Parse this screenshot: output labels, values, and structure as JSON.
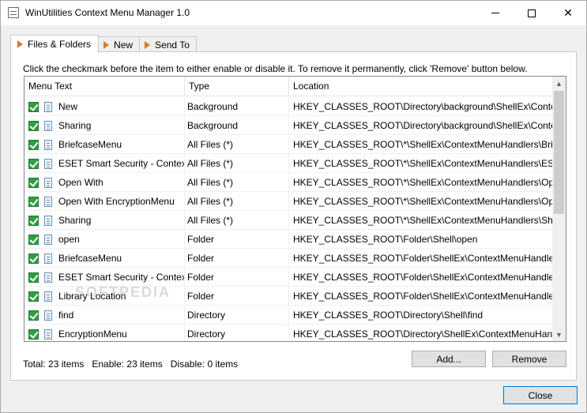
{
  "window": {
    "title": "WinUtilities Context Menu Manager 1.0",
    "controls": {
      "minimize": "minimize",
      "maximize": "maximize",
      "close": "close"
    }
  },
  "tabs": [
    {
      "label": "Files & Folders",
      "active": true
    },
    {
      "label": "New",
      "active": false
    },
    {
      "label": "Send To",
      "active": false
    }
  ],
  "instructions": "Click the checkmark before the item to either enable or disable it. To remove it permanently, click 'Remove' button below.",
  "table": {
    "columns": [
      "Menu Text",
      "Type",
      "Location"
    ],
    "rows": [
      {
        "menu_text": "New",
        "type": "Background",
        "location": "HKEY_CLASSES_ROOT\\Directory\\background\\ShellEx\\ContextMe..."
      },
      {
        "menu_text": "Sharing",
        "type": "Background",
        "location": "HKEY_CLASSES_ROOT\\Directory\\background\\ShellEx\\ContextMe..."
      },
      {
        "menu_text": "BriefcaseMenu",
        "type": "All Files (*)",
        "location": "HKEY_CLASSES_ROOT\\*\\ShellEx\\ContextMenuHandlers\\Briefcase..."
      },
      {
        "menu_text": "ESET Smart Security - Contex...",
        "type": "All Files (*)",
        "location": "HKEY_CLASSES_ROOT\\*\\ShellEx\\ContextMenuHandlers\\ESET Sm..."
      },
      {
        "menu_text": "Open With",
        "type": "All Files (*)",
        "location": "HKEY_CLASSES_ROOT\\*\\ShellEx\\ContextMenuHandlers\\Open With"
      },
      {
        "menu_text": "Open With EncryptionMenu",
        "type": "All Files (*)",
        "location": "HKEY_CLASSES_ROOT\\*\\ShellEx\\ContextMenuHandlers\\Open Wi..."
      },
      {
        "menu_text": "Sharing",
        "type": "All Files (*)",
        "location": "HKEY_CLASSES_ROOT\\*\\ShellEx\\ContextMenuHandlers\\Sharing"
      },
      {
        "menu_text": "open",
        "type": "Folder",
        "location": "HKEY_CLASSES_ROOT\\Folder\\Shell\\open"
      },
      {
        "menu_text": "BriefcaseMenu",
        "type": "Folder",
        "location": "HKEY_CLASSES_ROOT\\Folder\\ShellEx\\ContextMenuHandlers\\Brie..."
      },
      {
        "menu_text": "ESET Smart Security - Contex...",
        "type": "Folder",
        "location": "HKEY_CLASSES_ROOT\\Folder\\ShellEx\\ContextMenuHandlers\\ESE..."
      },
      {
        "menu_text": "Library Location",
        "type": "Folder",
        "location": "HKEY_CLASSES_ROOT\\Folder\\ShellEx\\ContextMenuHandlers\\Libr..."
      },
      {
        "menu_text": "find",
        "type": "Directory",
        "location": "HKEY_CLASSES_ROOT\\Directory\\Shell\\find"
      },
      {
        "menu_text": "EncryptionMenu",
        "type": "Directory",
        "location": "HKEY_CLASSES_ROOT\\Directory\\ShellEx\\ContextMenuHandlers\\E..."
      }
    ]
  },
  "watermark": "SOFTPEDIA",
  "buttons": {
    "add": "Add...",
    "remove": "Remove",
    "close": "Close"
  },
  "status": {
    "total": "Total: 23 items",
    "enable": "Enable: 23 items",
    "disable": "Disable: 0 items"
  },
  "colors": {
    "accent_arrow": "#e07a1f",
    "check_green": "#2ea043",
    "focus_blue": "#0078d7"
  },
  "icons": {
    "row_check": "checkbox-checked-icon",
    "row_doc": "document-icon"
  }
}
